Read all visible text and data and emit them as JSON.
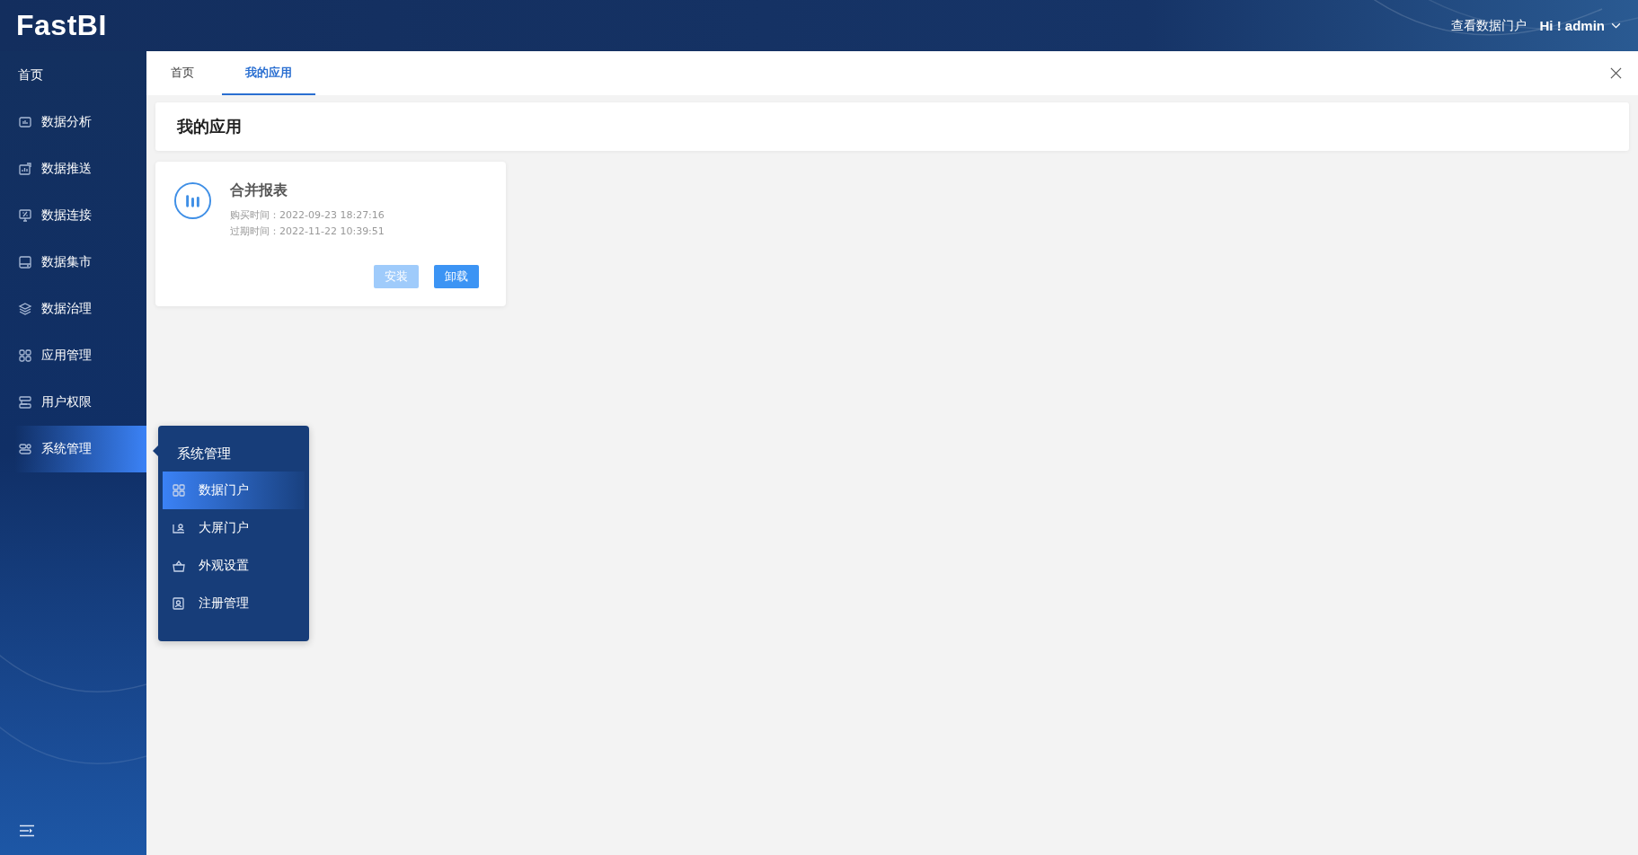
{
  "header": {
    "logo": "FastBI",
    "portal_link": "查看数据门户",
    "user": "Hi ! admin"
  },
  "sidebar": {
    "items": [
      {
        "label": "首页",
        "selected": false
      },
      {
        "label": "数据分析",
        "selected": false
      },
      {
        "label": "数据推送",
        "selected": false
      },
      {
        "label": "数据连接",
        "selected": false
      },
      {
        "label": "数据集市",
        "selected": false
      },
      {
        "label": "数据治理",
        "selected": false
      },
      {
        "label": "应用管理",
        "selected": false
      },
      {
        "label": "用户权限",
        "selected": false
      },
      {
        "label": "系统管理",
        "selected": true
      }
    ]
  },
  "submenu": {
    "title": "系统管理",
    "items": [
      {
        "label": "数据门户",
        "selected": true
      },
      {
        "label": "大屏门户",
        "selected": false
      },
      {
        "label": "外观设置",
        "selected": false
      },
      {
        "label": "注册管理",
        "selected": false
      }
    ]
  },
  "tabs": [
    {
      "label": "首页",
      "selected": false
    },
    {
      "label": "我的应用",
      "selected": true
    }
  ],
  "page_title": "我的应用",
  "apps": [
    {
      "name": "合并报表",
      "purchase": "购买时间：2022-09-23 18:27:16",
      "expiry": "过期时间：2022-11-22 10:39:51",
      "buttons": [
        {
          "label": "安装",
          "disabled": true
        },
        {
          "label": "卸载",
          "disabled": false
        }
      ]
    }
  ]
}
